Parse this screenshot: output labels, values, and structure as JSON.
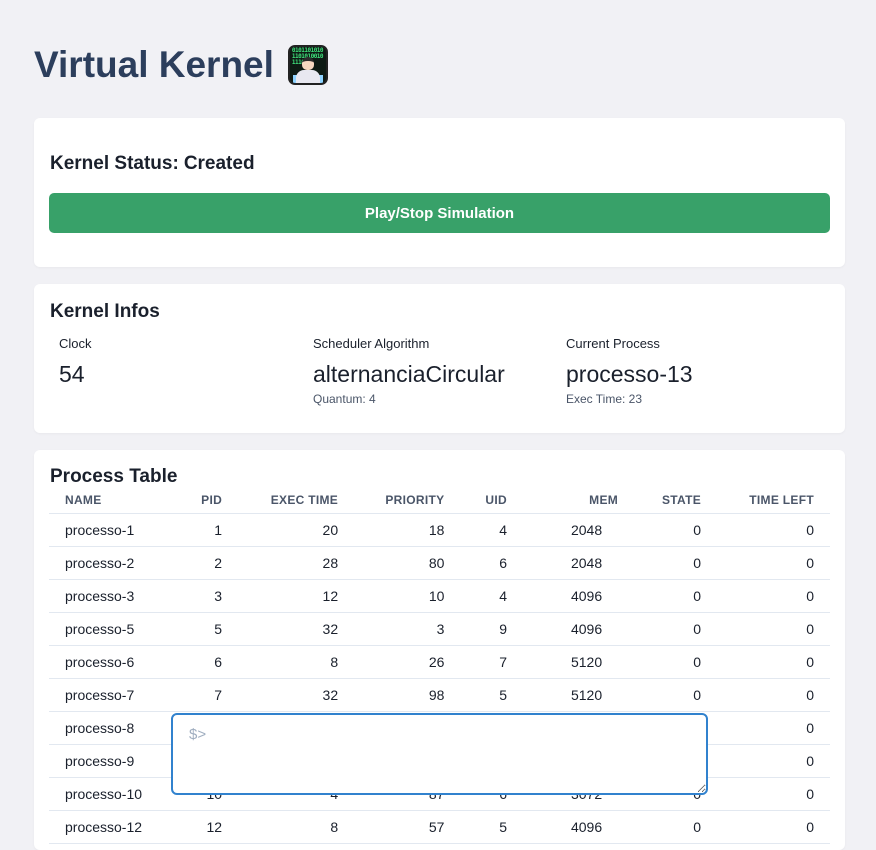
{
  "header": {
    "title": "Virtual Kernel",
    "emoji_icon": "technologist-emoji-icon"
  },
  "status_card": {
    "label": "Kernel Status:",
    "value": "Created",
    "button_label": "Play/Stop Simulation",
    "button_color": "#38a169"
  },
  "infos_card": {
    "title": "Kernel Infos",
    "clock": {
      "label": "Clock",
      "value": "54"
    },
    "scheduler": {
      "label": "Scheduler Algorithm",
      "value": "alternanciaCircular",
      "help": "Quantum: 4"
    },
    "current_process": {
      "label": "Current Process",
      "value": "processo-13",
      "help": "Exec Time: 23"
    }
  },
  "process_table": {
    "title": "Process Table",
    "columns": [
      "NAME",
      "PID",
      "EXEC TIME",
      "PRIORITY",
      "UID",
      "MEM",
      "STATE",
      "TIME LEFT"
    ],
    "rows": [
      [
        "processo-1",
        "1",
        "20",
        "18",
        "4",
        "2048",
        "0",
        "0"
      ],
      [
        "processo-2",
        "2",
        "28",
        "80",
        "6",
        "2048",
        "0",
        "0"
      ],
      [
        "processo-3",
        "3",
        "12",
        "10",
        "4",
        "4096",
        "0",
        "0"
      ],
      [
        "processo-5",
        "5",
        "32",
        "3",
        "9",
        "4096",
        "0",
        "0"
      ],
      [
        "processo-6",
        "6",
        "8",
        "26",
        "7",
        "5120",
        "0",
        "0"
      ],
      [
        "processo-7",
        "7",
        "32",
        "98",
        "5",
        "5120",
        "0",
        "0"
      ],
      [
        "processo-8",
        "",
        "",
        "",
        "",
        "",
        "",
        "0"
      ],
      [
        "processo-9",
        "",
        "",
        "",
        "",
        "",
        "",
        "0"
      ],
      [
        "processo-10",
        "10",
        "4",
        "87",
        "6",
        "3072",
        "0",
        "0"
      ],
      [
        "processo-12",
        "12",
        "8",
        "57",
        "5",
        "4096",
        "0",
        "0"
      ]
    ]
  },
  "terminal": {
    "placeholder": "$>",
    "value": ""
  }
}
